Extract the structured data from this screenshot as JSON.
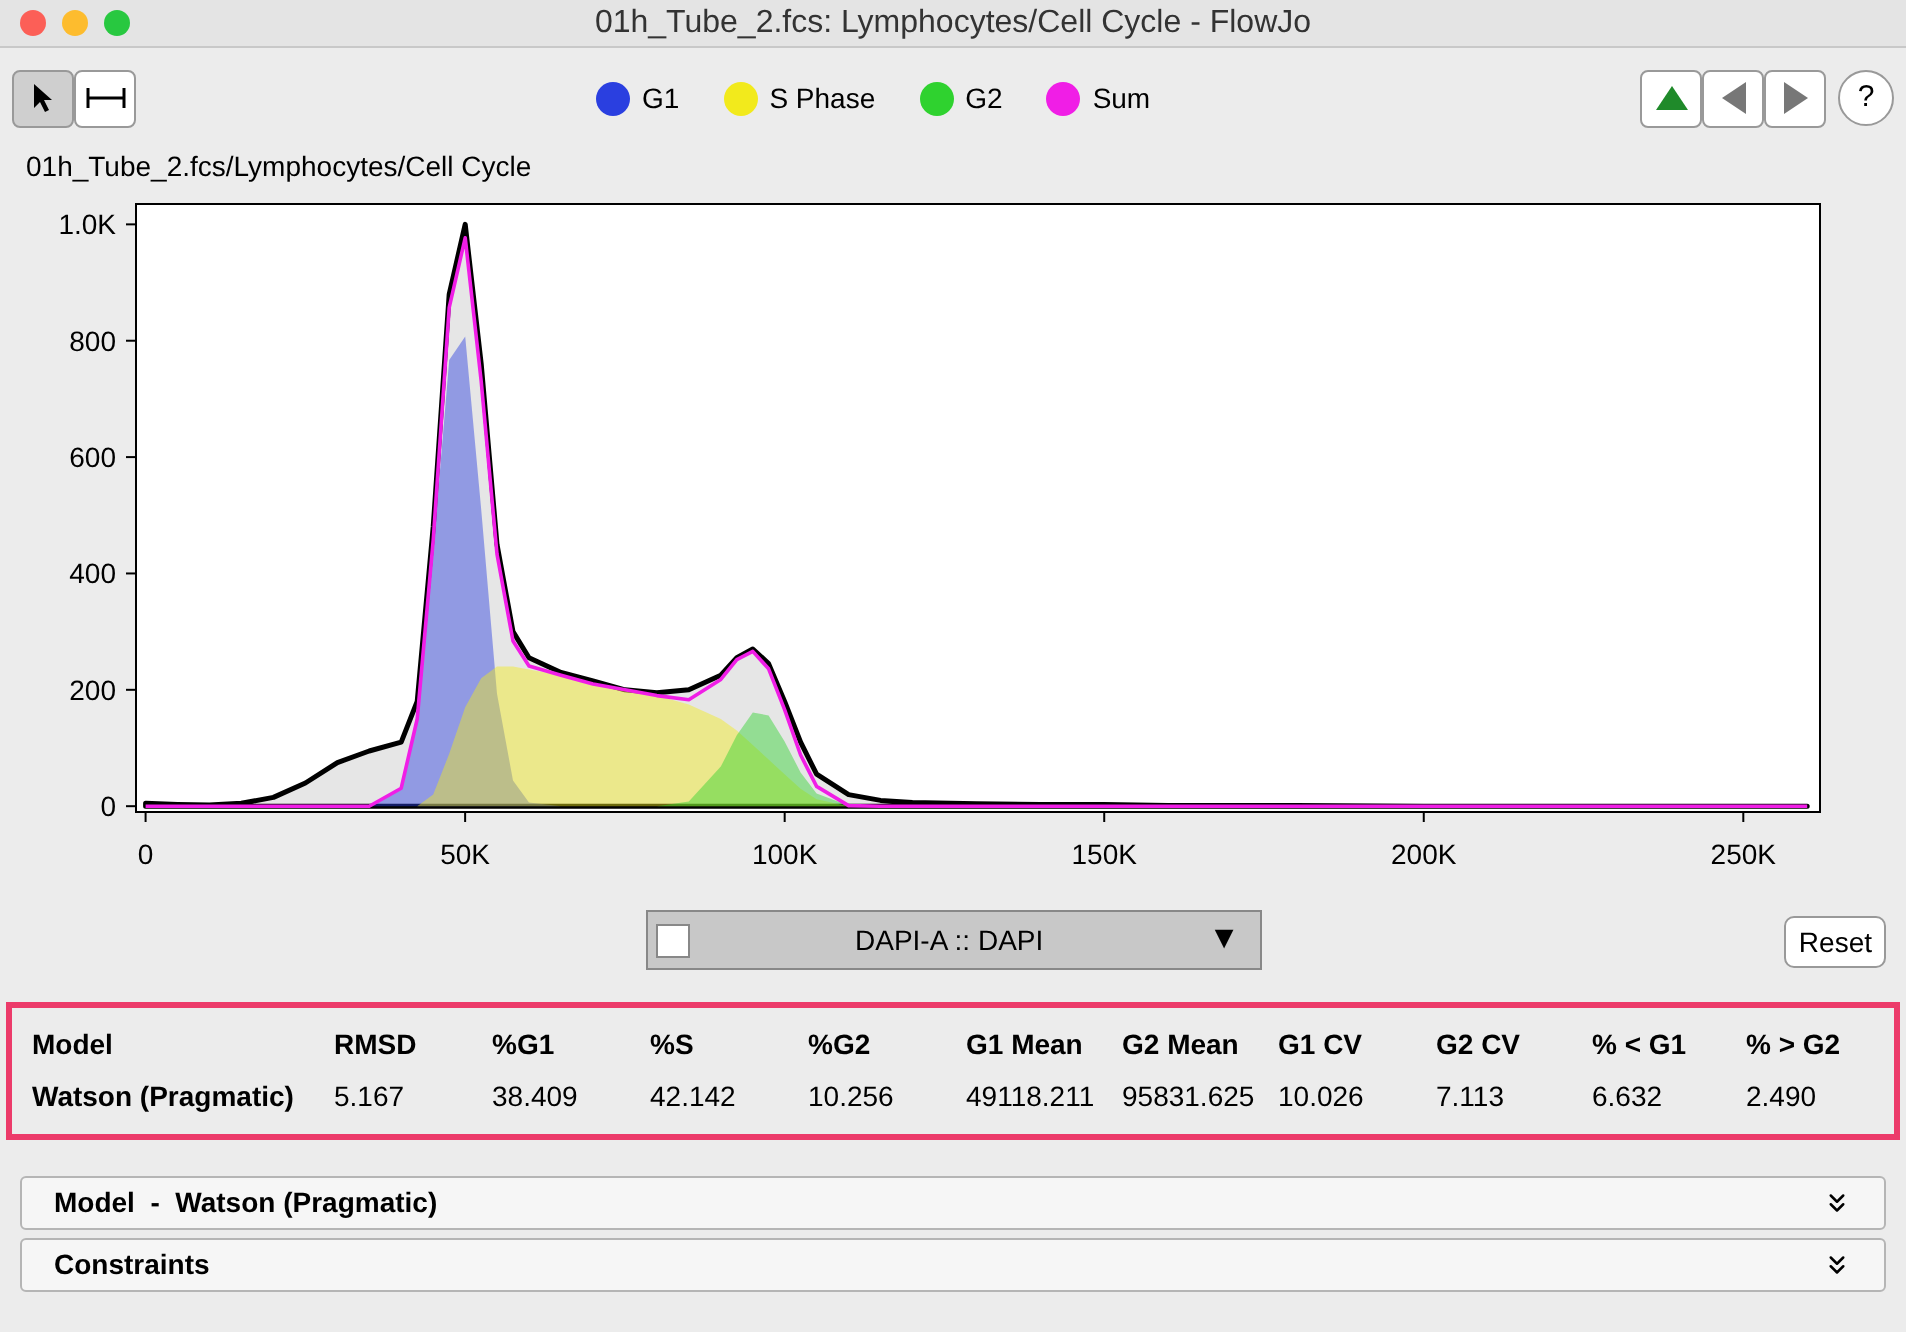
{
  "window": {
    "title": "01h_Tube_2.fcs: Lymphocytes/Cell Cycle - FlowJo"
  },
  "tools": [
    {
      "kind": "pointer",
      "selected": true
    },
    {
      "kind": "range",
      "selected": false
    }
  ],
  "nav_buttons": [
    {
      "kind": "up"
    },
    {
      "kind": "back"
    },
    {
      "kind": "forward"
    },
    {
      "kind": "help",
      "label": "?"
    }
  ],
  "path": "01h_Tube_2.fcs/Lymphocytes/Cell Cycle",
  "chart_data": {
    "type": "area",
    "x": [
      0,
      5000,
      10000,
      15000,
      20000,
      25000,
      30000,
      35000,
      40000,
      42500,
      45000,
      47500,
      50000,
      52500,
      55000,
      57500,
      60000,
      65000,
      70000,
      75000,
      80000,
      85000,
      90000,
      92500,
      95000,
      97500,
      100000,
      102500,
      105000,
      110000,
      115000,
      120000,
      130000,
      140000,
      150000,
      160000,
      180000,
      200000,
      220000,
      240000,
      260000
    ],
    "series": [
      {
        "color": "#000000",
        "values": [
          5,
          3,
          2,
          5,
          15,
          40,
          75,
          95,
          110,
          180,
          480,
          880,
          1000,
          760,
          450,
          300,
          255,
          230,
          215,
          200,
          195,
          200,
          225,
          255,
          270,
          245,
          180,
          110,
          55,
          20,
          10,
          6,
          4,
          3,
          3,
          1,
          1,
          0,
          0,
          0,
          0
        ]
      },
      {
        "name": "G1",
        "color": "#2a3fe0",
        "values": [
          0,
          0,
          0,
          0,
          0,
          0,
          0,
          0,
          31,
          150,
          437,
          767,
          807,
          510,
          193,
          44,
          6,
          0,
          0,
          0,
          0,
          0,
          0,
          0,
          0,
          0,
          0,
          0,
          0,
          0,
          0,
          0,
          0,
          0,
          0,
          0,
          0,
          0,
          0,
          0,
          0
        ]
      },
      {
        "name": "S Phase",
        "color": "#f2ea1c",
        "values": [
          0,
          0,
          0,
          0,
          0,
          0,
          0,
          0,
          0,
          0,
          20,
          90,
          170,
          220,
          240,
          240,
          235,
          225,
          210,
          200,
          190,
          175,
          150,
          130,
          105,
          80,
          55,
          30,
          12,
          0,
          0,
          0,
          0,
          0,
          0,
          0,
          0,
          0,
          0,
          0,
          0
        ]
      },
      {
        "name": "G2",
        "color": "#2fd22f",
        "values": [
          0,
          0,
          0,
          0,
          0,
          0,
          0,
          0,
          0,
          0,
          0,
          0,
          0,
          0,
          0,
          0,
          0,
          0,
          0,
          0,
          0,
          8,
          68,
          122,
          161,
          156,
          111,
          58,
          22,
          1,
          0,
          0,
          0,
          0,
          0,
          0,
          0,
          0,
          0,
          0,
          0
        ]
      },
      {
        "name": "Sum",
        "type": "line",
        "color": "#f01ee6",
        "values": [
          0,
          0,
          0,
          0,
          0,
          0,
          0,
          0,
          31,
          150,
          457,
          857,
          977,
          730,
          433,
          284,
          241,
          225,
          210,
          200,
          190,
          183,
          218,
          252,
          266,
          236,
          166,
          88,
          34,
          1,
          0,
          0,
          0,
          0,
          0,
          0,
          0,
          0,
          0,
          0,
          0
        ]
      }
    ],
    "xlim": [
      -1500,
      262000
    ],
    "ylim": [
      -10,
      1035
    ],
    "xticks": [
      {
        "value": 0,
        "label": "0"
      },
      {
        "value": 50000,
        "label": "50K"
      },
      {
        "value": 100000,
        "label": "100K"
      },
      {
        "value": 150000,
        "label": "150K"
      },
      {
        "value": 200000,
        "label": "200K"
      },
      {
        "value": 250000,
        "label": "250K"
      }
    ],
    "yticks": [
      {
        "value": 0,
        "label": "0"
      },
      {
        "value": 200,
        "label": "200"
      },
      {
        "value": 400,
        "label": "400"
      },
      {
        "value": 600,
        "label": "600"
      },
      {
        "value": 800,
        "label": "800"
      },
      {
        "value": 1000,
        "label": "1.0K"
      }
    ]
  },
  "parameter_select": {
    "checked": false,
    "value": "DAPI-A :: DAPI",
    "arrow": "▼"
  },
  "reset_button": "Reset",
  "results": {
    "columns": [
      "Model",
      "RMSD",
      "%G1",
      "%S",
      "%G2",
      "G1 Mean",
      "G2 Mean",
      "G1 CV",
      "G2 CV",
      "% < G1",
      "% > G2"
    ],
    "row": [
      "Watson (Pragmatic)",
      "5.167",
      "38.409",
      "42.142",
      "10.256",
      "49118.211",
      "95831.625",
      "10.026",
      "7.113",
      "6.632",
      "2.490"
    ]
  },
  "panels": [
    {
      "title": "Model  -  Watson (Pragmatic)",
      "expanded": false
    },
    {
      "title": "Constraints",
      "expanded": false
    }
  ]
}
